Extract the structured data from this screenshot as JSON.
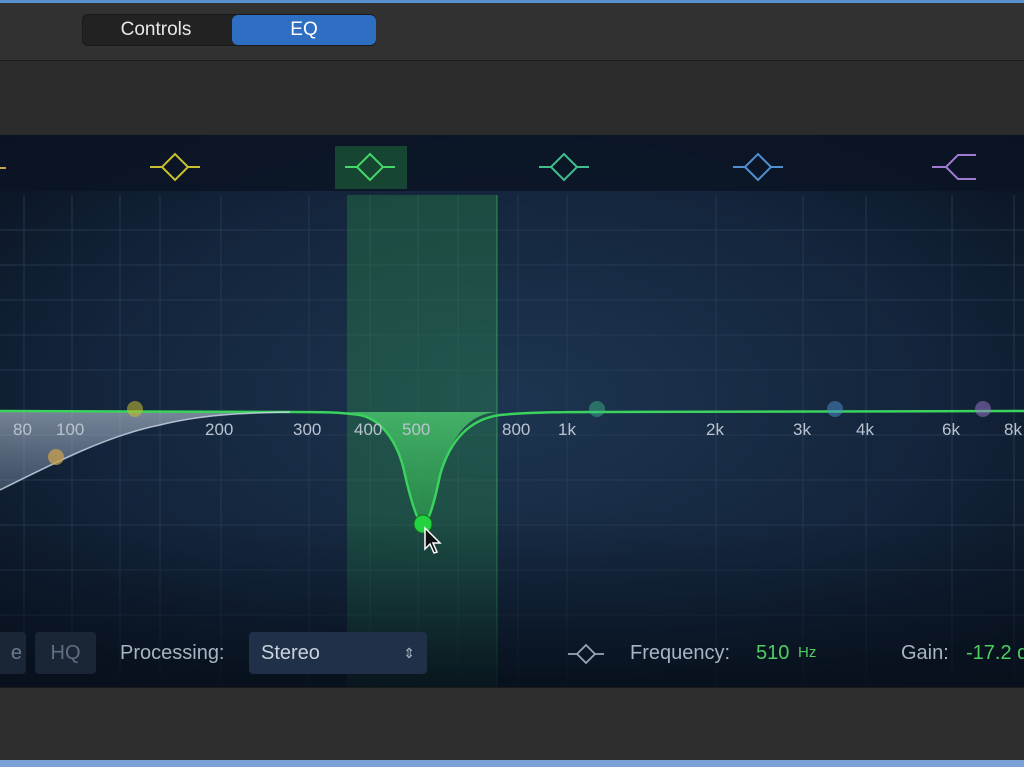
{
  "tabs": {
    "controls": "Controls",
    "eq": "EQ"
  },
  "graph": {
    "freq_labels": [
      "80",
      "100",
      "200",
      "300",
      "400",
      "500",
      "800",
      "1k",
      "2k",
      "3k",
      "4k",
      "6k",
      "8k"
    ]
  },
  "bottom": {
    "clipped_button": "e",
    "hq": "HQ",
    "processing_label": "Processing:",
    "processing_value": "Stereo",
    "frequency_label": "Frequency:",
    "frequency_value": "510",
    "frequency_unit": "Hz",
    "gain_label": "Gain:",
    "gain_value": "-17.2 d"
  },
  "colors": {
    "accent_blue": "#2f6fc3",
    "active_band": "#38c85a",
    "band2": "#c8c02e",
    "band4": "#3fbf8c",
    "band5": "#4f8fd0",
    "band6": "#a07ad0"
  },
  "icons": {
    "band2": "band-peak-icon",
    "band3": "band-peak-icon",
    "band4": "band-peak-icon",
    "band5": "band-peak-icon",
    "band6": "high-shelf-icon",
    "selected": "band-peak-icon",
    "cursor": "mouse-pointer-icon"
  }
}
